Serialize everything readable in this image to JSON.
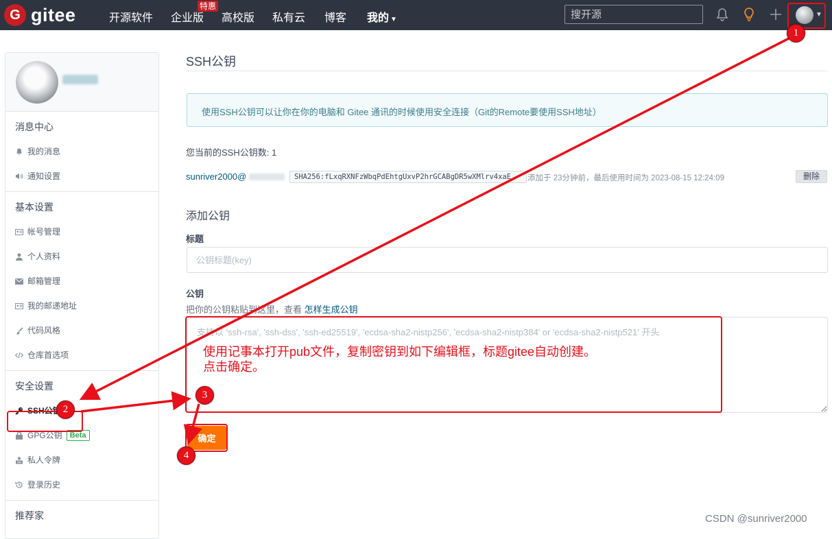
{
  "nav": {
    "logo_letter": "G",
    "logo_text": "gitee",
    "items": [
      "开源软件",
      "企业版",
      "高校版",
      "私有云",
      "博客"
    ],
    "enterprise_badge": "特惠",
    "mine_label": "我的",
    "search_placeholder": "搜开源"
  },
  "sidebar": {
    "sections": [
      {
        "title": "消息中心",
        "items": [
          {
            "label": "我的消息",
            "icon": "bell-icon"
          },
          {
            "label": "通知设置",
            "icon": "speaker-icon"
          }
        ]
      },
      {
        "title": "基本设置",
        "items": [
          {
            "label": "帐号管理",
            "icon": "id-card-icon"
          },
          {
            "label": "个人资料",
            "icon": "user-icon"
          },
          {
            "label": "邮箱管理",
            "icon": "mail-icon"
          },
          {
            "label": "我的邮递地址",
            "icon": "address-card-icon"
          },
          {
            "label": "代码风格",
            "icon": "brush-icon"
          },
          {
            "label": "仓库首选项",
            "icon": "code-icon"
          }
        ]
      },
      {
        "title": "安全设置",
        "items": [
          {
            "label": "SSH公钥",
            "icon": "key-icon",
            "active": true
          },
          {
            "label": "GPG公钥",
            "icon": "lock-icon",
            "badge": "Beta"
          },
          {
            "label": "私人令牌",
            "icon": "token-icon"
          },
          {
            "label": "登录历史",
            "icon": "history-icon"
          }
        ]
      }
    ],
    "next_section_title": "推荐家"
  },
  "main": {
    "title": "SSH公钥",
    "info": "使用SSH公钥可以让你在你的电脑和 Gitee 通讯的时候使用安全连接（Git的Remote要使用SSH地址）",
    "key_count_text": "您当前的SSH公钥数: 1",
    "key": {
      "owner": "sunriver2000@",
      "fingerprint": "SHA256:fLxqRXNFzWbqPdEhtgUxvP2hrGCABgDR5wXMlrv4xaE",
      "meta": "添加于 23分钟前，最后使用时间为 2023-08-15 12:24:09",
      "delete_label": "删除"
    },
    "add_title": "添加公钥",
    "title_label": "标题",
    "title_placeholder": "公钥标题(key)",
    "key_label": "公钥",
    "key_hint": "把你的公钥粘贴到这里，查看 ",
    "key_hint_link": "怎样生成公钥",
    "key_placeholder": "支持以 'ssh-rsa', 'ssh-dss', 'ssh-ed25519', 'ecdsa-sha2-nistp256', 'ecdsa-sha2-nistp384' or 'ecdsa-sha2-nistp521' 开头",
    "confirm_label": "确定"
  },
  "annotations": {
    "note_line1": "使用记事本打开pub文件，复制密钥到如下编辑框，标题gitee自动创建。",
    "note_line2": "点击确定。",
    "markers": [
      "1",
      "2",
      "3",
      "4"
    ],
    "color": "#e8101a"
  },
  "watermark": "CSDN @sunriver2000"
}
